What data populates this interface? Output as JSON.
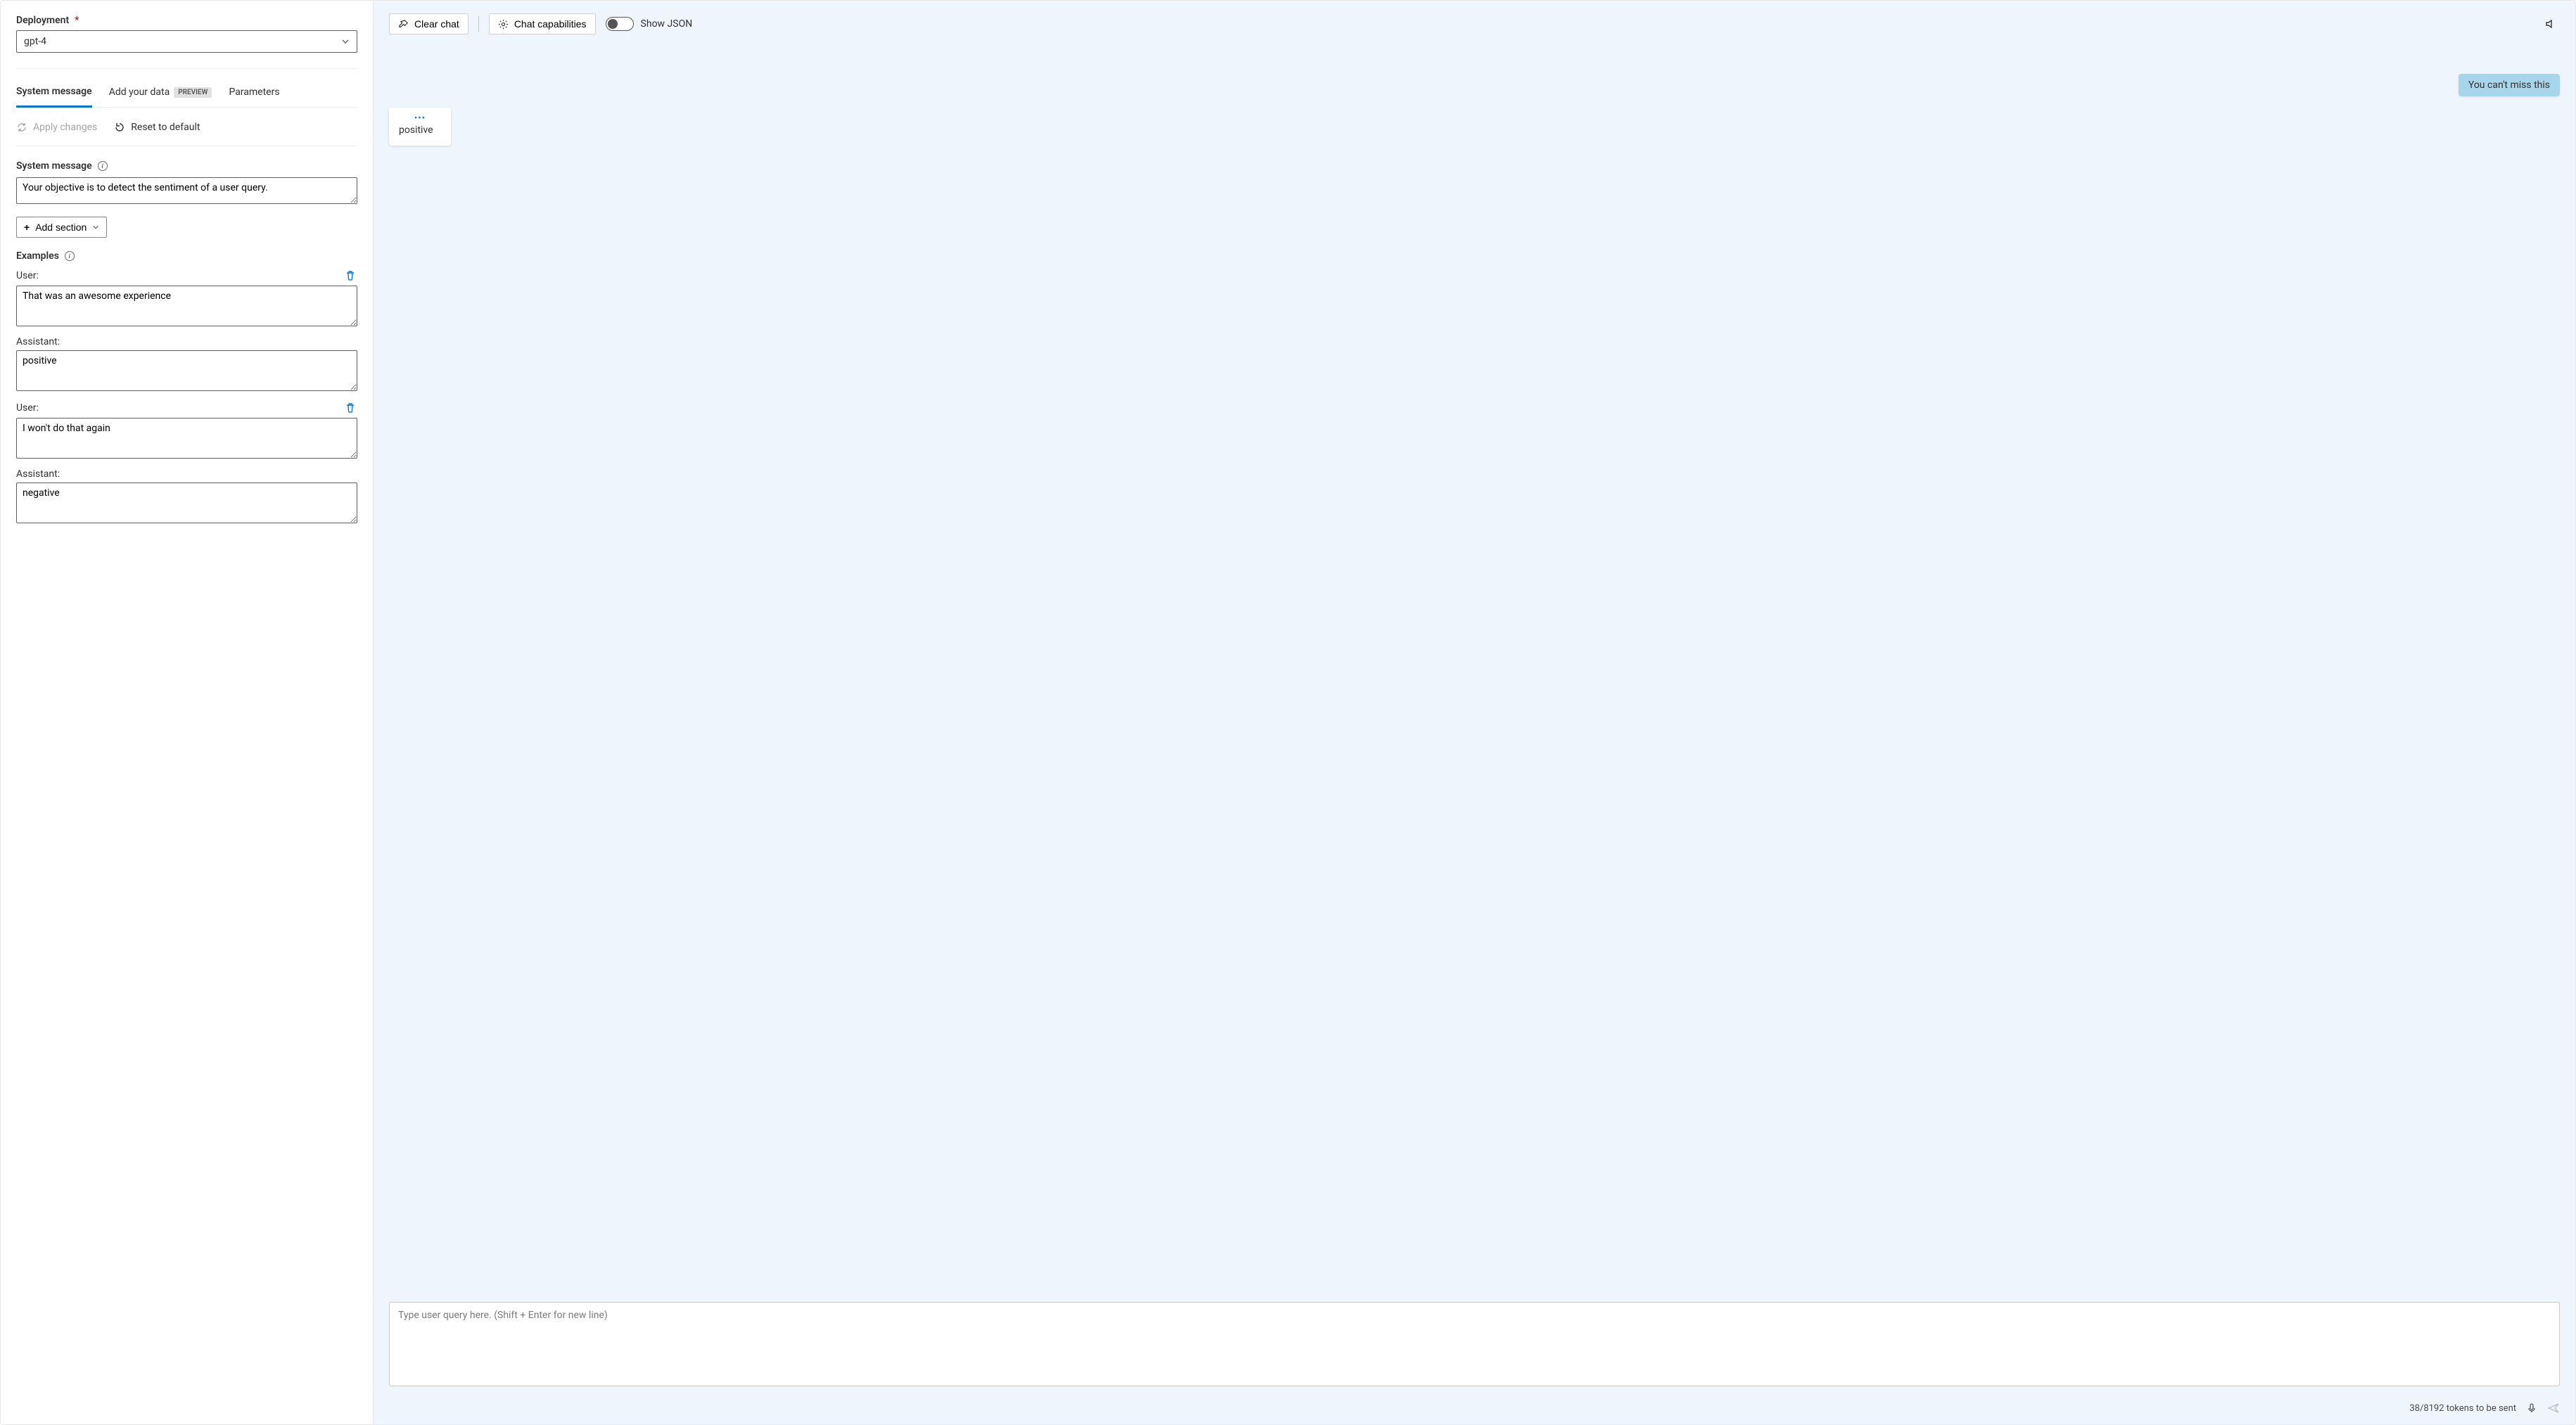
{
  "deployment": {
    "label": "Deployment",
    "value": "gpt-4"
  },
  "tabs": {
    "system_message": "System message",
    "add_data": "Add your data",
    "add_data_badge": "PREVIEW",
    "parameters": "Parameters"
  },
  "subtoolbar": {
    "apply_changes": "Apply changes",
    "reset_default": "Reset to default"
  },
  "system_message_section": {
    "label": "System message",
    "value": "Your objective is to detect the sentiment of a user query."
  },
  "add_section_label": "Add section",
  "examples_label": "Examples",
  "examples": [
    {
      "user_label": "User:",
      "user_value": "That was an awesome experience",
      "assistant_label": "Assistant:",
      "assistant_value": "positive"
    },
    {
      "user_label": "User:",
      "user_value": "I won't do that again",
      "assistant_label": "Assistant:",
      "assistant_value": "negative"
    }
  ],
  "chat_toolbar": {
    "clear_chat": "Clear chat",
    "chat_capabilities": "Chat capabilities",
    "show_json": "Show JSON"
  },
  "chat": {
    "user_message": "You can't miss this",
    "assistant_message": "positive",
    "input_placeholder": "Type user query here. (Shift + Enter for new line)"
  },
  "footer": {
    "token_status": "38/8192 tokens to be sent"
  }
}
